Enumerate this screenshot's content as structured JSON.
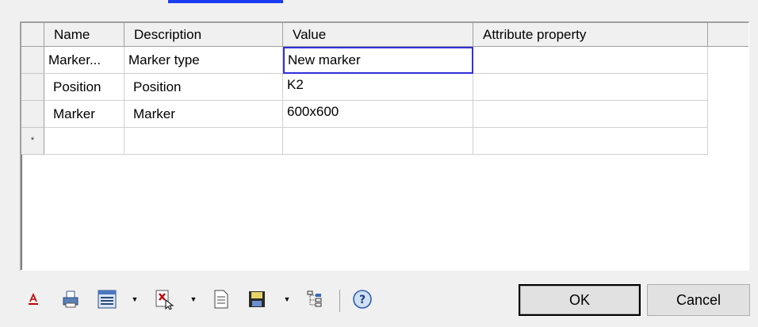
{
  "grid": {
    "columns": [
      "Name",
      "Description",
      "Value",
      "Attribute property"
    ],
    "rows": [
      {
        "name": "Marker...",
        "description": "Marker type",
        "value": "New marker",
        "attribute": ""
      },
      {
        "name": "Position",
        "description": "Position",
        "value": "K2",
        "attribute": ""
      },
      {
        "name": "Marker",
        "description": "Marker",
        "value": "600x600",
        "attribute": ""
      }
    ],
    "new_row_marker": "*"
  },
  "toolbar": {
    "icons": [
      "font-color-icon",
      "print-icon",
      "layout-icon",
      "delete-icon",
      "document-icon",
      "save-icon",
      "tree-icon",
      "help-icon"
    ]
  },
  "buttons": {
    "ok_label": "OK",
    "cancel_label": "Cancel"
  },
  "colors": {
    "active_cell_border": "#3030d8",
    "link_strip": "#1a3cf2"
  }
}
